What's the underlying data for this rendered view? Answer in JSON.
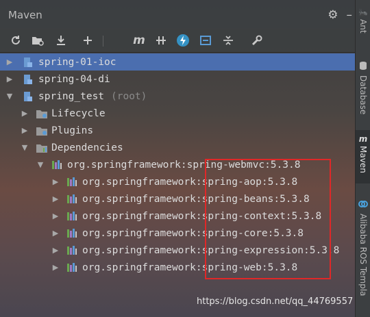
{
  "title": "Maven",
  "header_icons": [
    "gear-icon",
    "hide-icon"
  ],
  "toolbar": {
    "buttons": [
      "reload-icon",
      "add-folder-icon",
      "download-icon",
      "add-icon",
      "execute-goal-icon",
      "toggle-offline-icon",
      "lightning-icon",
      "show-dependencies-icon",
      "collapse-all-icon",
      "settings-wrench-icon"
    ],
    "execute_label": "m"
  },
  "tree": {
    "rows": [
      {
        "label": "spring-01-ioc",
        "suffix": ""
      },
      {
        "label": "spring-04-di",
        "suffix": ""
      },
      {
        "label": "spring_test",
        "suffix": "(root)"
      },
      {
        "label": "Lifecycle",
        "suffix": ""
      },
      {
        "label": "Plugins",
        "suffix": ""
      },
      {
        "label": "Dependencies",
        "suffix": ""
      },
      {
        "label": "org.springframework:spring-webmvc:5.3.8",
        "suffix": ""
      },
      {
        "label": "org.springframework:spring-aop:5.3.8",
        "suffix": ""
      },
      {
        "label": "org.springframework:spring-beans:5.3.8",
        "suffix": ""
      },
      {
        "label": "org.springframework:spring-context:5.3.8",
        "suffix": ""
      },
      {
        "label": "org.springframework:spring-core:5.3.8",
        "suffix": ""
      },
      {
        "label": "org.springframework:spring-expression:5.3.8",
        "suffix": ""
      },
      {
        "label": "org.springframework:spring-web:5.3.8",
        "suffix": ""
      }
    ]
  },
  "side_tabs": [
    {
      "label": "Ant",
      "icon": "ant-icon"
    },
    {
      "label": "Database",
      "icon": "database-icon"
    },
    {
      "label": "Maven",
      "icon": "maven-icon",
      "glyph": "m"
    },
    {
      "label": "Alibaba ROS Templa",
      "icon": "alibaba-icon"
    }
  ],
  "watermark": "https://blog.csdn.net/qq_44769557",
  "colors": {
    "selection": "#4b6eaf",
    "highlight_box": "#e02828",
    "dependency_icon": "#6aa84f"
  }
}
